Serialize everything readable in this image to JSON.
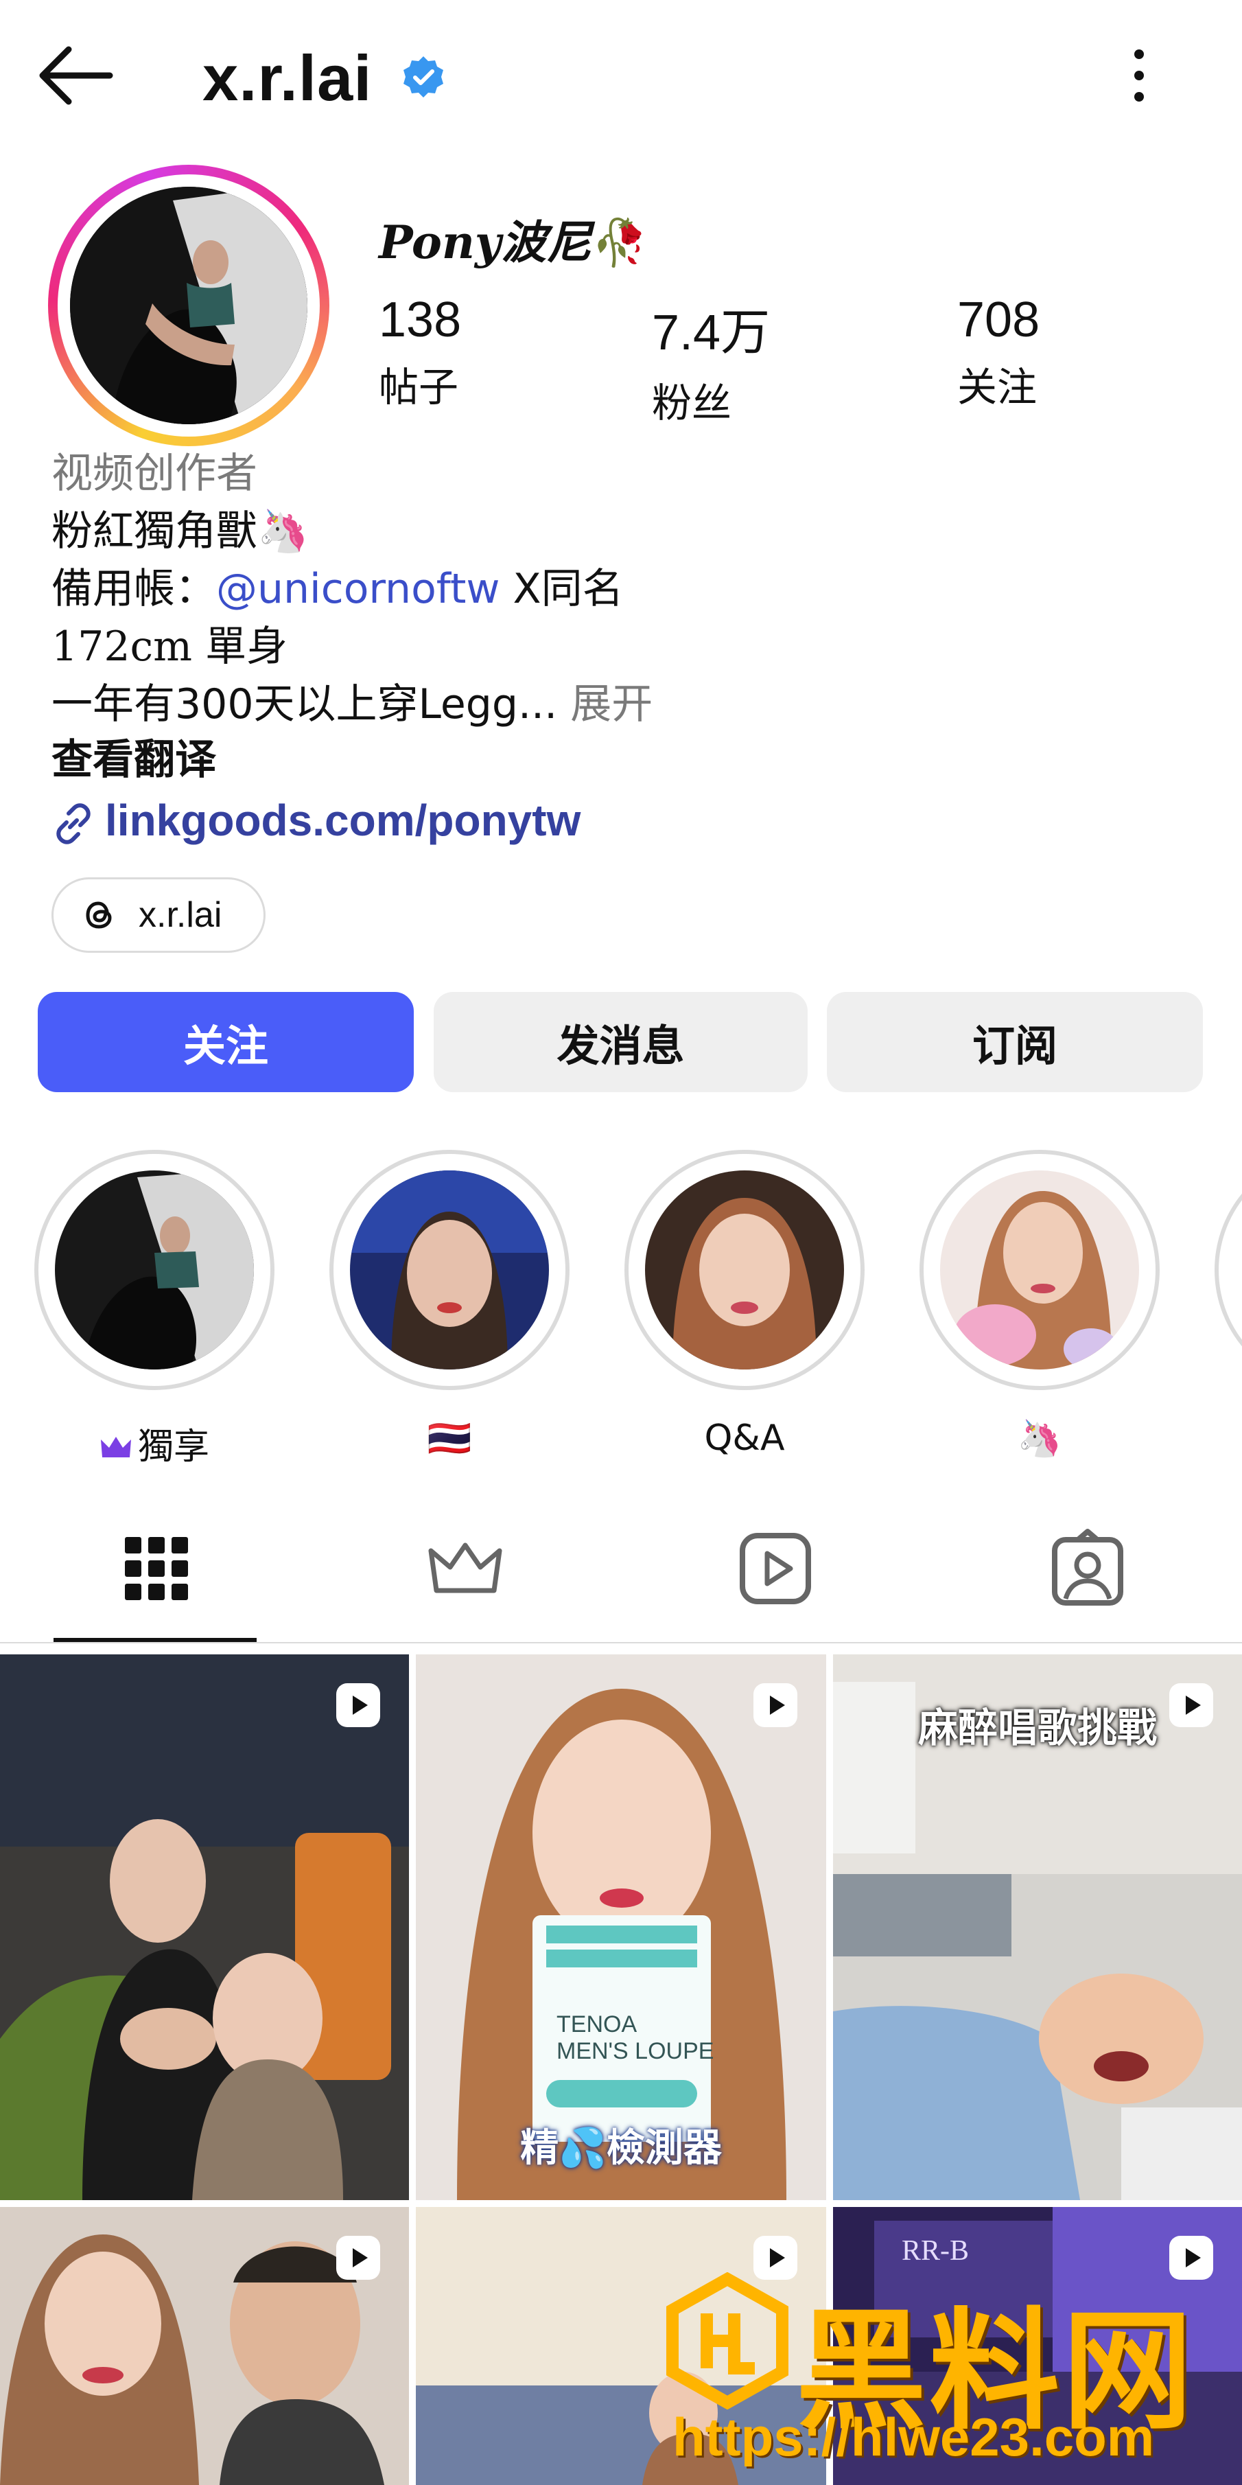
{
  "header": {
    "username": "x.r.lai",
    "verified_color": "#3897f0",
    "back_icon": "arrow-left-icon",
    "more_icon": "more-vertical-icon"
  },
  "profile": {
    "display_name": "Pony波尼",
    "display_name_emoji": "🥀",
    "stats": [
      {
        "value": "138",
        "label": "帖子"
      },
      {
        "value": "7.4万",
        "label": "粉丝"
      },
      {
        "value": "708",
        "label": "关注"
      }
    ],
    "category": "视频创作者",
    "bio": {
      "line1": "粉紅獨角獸",
      "line1_emoji": "🦄",
      "line2_prefix": "備用帳：",
      "line2_mention": "@unicornoftw",
      "line2_suffix": " X同名",
      "line3": "172cm 單身",
      "line4": "一年有300天以上穿Legg...",
      "expand": " 展开"
    },
    "translate": "查看翻译",
    "link": "linkgoods.com/ponytw",
    "threads_handle": "x.r.lai"
  },
  "actions": {
    "follow": "关注",
    "message": "发消息",
    "subscribe": "订阅"
  },
  "highlights": [
    {
      "caption": "獨享",
      "icon": "crown-icon"
    },
    {
      "caption": "🇹🇭"
    },
    {
      "caption": "Q&A"
    },
    {
      "caption": "🦄"
    }
  ],
  "tabs": [
    {
      "name": "posts",
      "icon": "grid-icon",
      "active": true
    },
    {
      "name": "subscriber",
      "icon": "crown-icon",
      "active": false
    },
    {
      "name": "reels",
      "icon": "reels-icon",
      "active": false
    },
    {
      "name": "tagged",
      "icon": "tagged-person-icon",
      "active": false
    }
  ],
  "grid": [
    {
      "top_caption": "",
      "sub_caption": "",
      "bottom_caption": ""
    },
    {
      "top_caption": "",
      "sub_caption": "",
      "bottom_caption": "精💦檢測器",
      "product_line1": "TENOA",
      "product_line2": "MEN'S LOUPE"
    },
    {
      "top_caption": "麻醉唱歌挑戰",
      "sub_caption": "",
      "bottom_caption": ""
    },
    {
      "top_caption": "",
      "sub_caption": "",
      "bottom_caption": ""
    },
    {
      "top_caption": "",
      "sub_caption": "",
      "bottom_caption": ""
    },
    {
      "top_caption": "",
      "sub_caption": "",
      "bottom_caption": "",
      "sign_text": "RR-B"
    }
  ],
  "watermark": {
    "text": "黑料网",
    "url": "https://hlwe23.com"
  },
  "colors": {
    "accent": "#4a5df9",
    "link": "#35419f",
    "mention": "#3a4ec9",
    "secondary_button": "#efefef",
    "muted_text": "#7a7a7a"
  }
}
